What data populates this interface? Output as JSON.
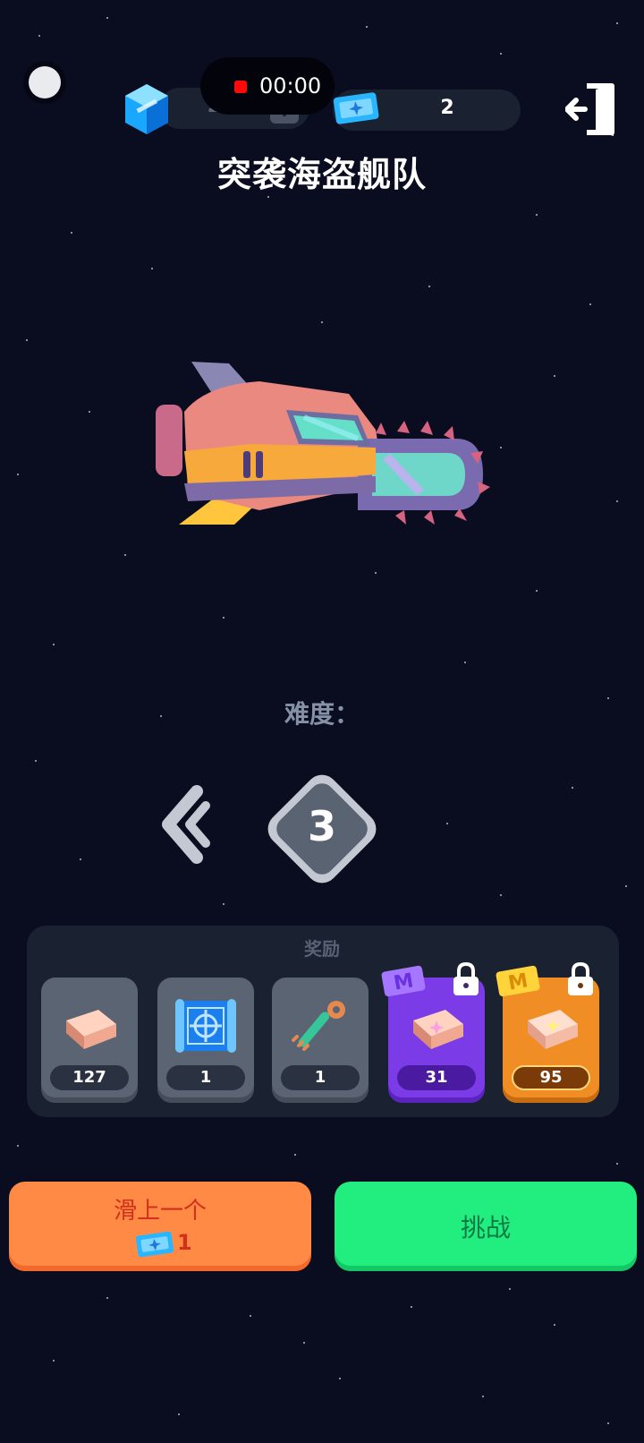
{
  "topbar": {
    "gem_count": "25",
    "plus_label": "+",
    "record_time": "00:00",
    "ticket_count": "2"
  },
  "title": "突袭海盗舰队",
  "difficulty": {
    "label": "难度：",
    "value": "3"
  },
  "rewards": {
    "title": "奖励",
    "items": [
      {
        "icon": "copper-ingot-icon",
        "count": "127",
        "style": "grey",
        "locked": false
      },
      {
        "icon": "blueprint-icon",
        "count": "1",
        "style": "grey",
        "locked": false
      },
      {
        "icon": "green-key-icon",
        "count": "1",
        "style": "grey",
        "locked": false
      },
      {
        "icon": "copper-ingot-icon",
        "count": "31",
        "style": "purple",
        "locked": true,
        "badge": "M"
      },
      {
        "icon": "copper-ingot-icon",
        "count": "95",
        "style": "orange",
        "locked": true,
        "badge": "M"
      }
    ]
  },
  "buttons": {
    "prev_label": "滑上一个",
    "prev_cost": "1",
    "challenge_label": "挑战"
  },
  "colors": {
    "background": "#0a0c1f",
    "prev_button": "#ff8a45",
    "challenge_button": "#22ee80"
  }
}
